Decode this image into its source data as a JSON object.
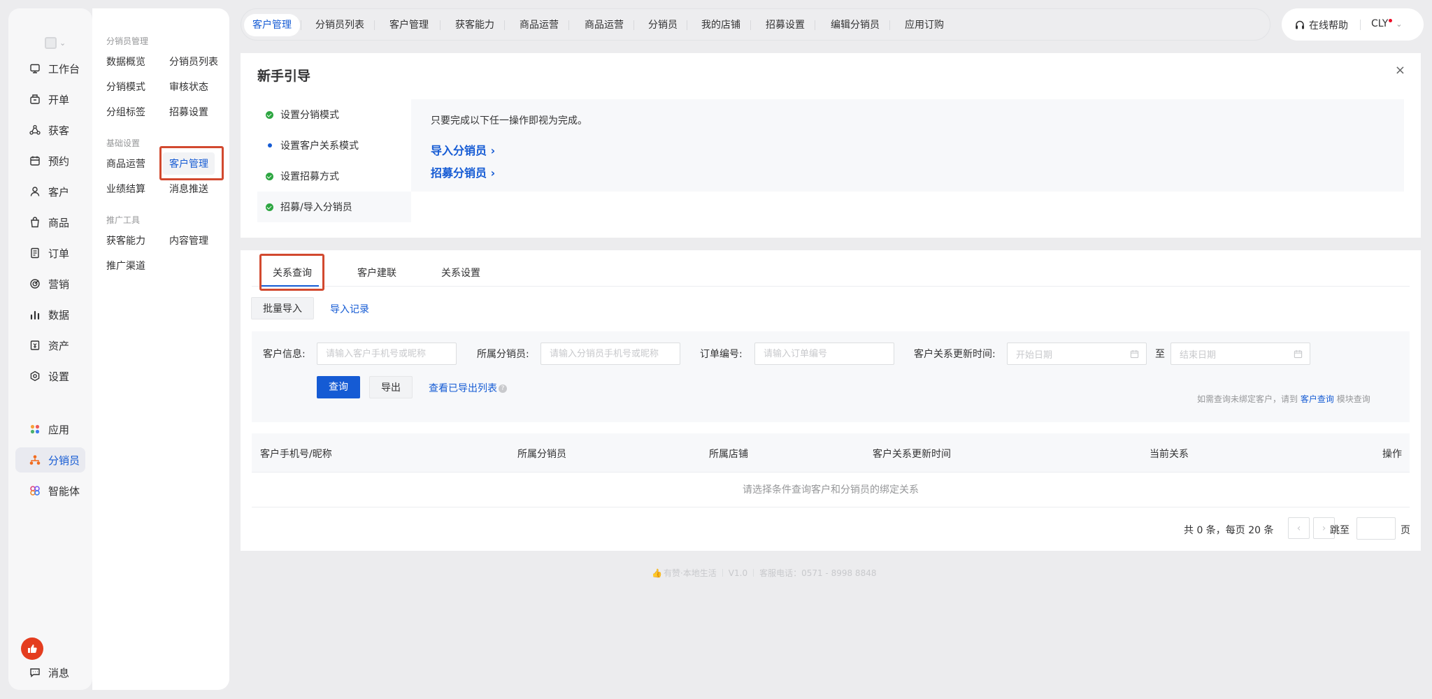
{
  "sidebar": {
    "items": [
      {
        "label": "工作台",
        "icon": "workbench-icon"
      },
      {
        "label": "开单",
        "icon": "cashier-icon"
      },
      {
        "label": "获客",
        "icon": "acquire-icon"
      },
      {
        "label": "预约",
        "icon": "calendar-icon"
      },
      {
        "label": "客户",
        "icon": "user-icon"
      },
      {
        "label": "商品",
        "icon": "bag-icon"
      },
      {
        "label": "订单",
        "icon": "order-icon"
      },
      {
        "label": "营销",
        "icon": "target-icon"
      },
      {
        "label": "数据",
        "icon": "chart-icon"
      },
      {
        "label": "资产",
        "icon": "asset-icon"
      },
      {
        "label": "设置",
        "icon": "gear-icon"
      },
      {
        "label": "应用",
        "icon": "apps-icon"
      },
      {
        "label": "分销员",
        "icon": "distributor-icon"
      },
      {
        "label": "智能体",
        "icon": "agent-icon"
      },
      {
        "label": "消息",
        "icon": "message-icon"
      }
    ]
  },
  "subnav": {
    "groups": [
      "分销员管理",
      "基础设置",
      "推广工具"
    ],
    "links": [
      "数据概览",
      "分销员列表",
      "分销模式",
      "审核状态",
      "分组标签",
      "招募设置",
      "商品运营",
      "客户管理",
      "业绩结算",
      "消息推送",
      "获客能力",
      "内容管理",
      "推广渠道"
    ]
  },
  "toptabs": [
    "客户管理",
    "分销员列表",
    "客户管理",
    "获客能力",
    "商品运营",
    "商品运营",
    "分销员",
    "我的店铺",
    "招募设置",
    "编辑分销员",
    "应用订购"
  ],
  "header": {
    "help": "在线帮助",
    "user": "CLY"
  },
  "guide": {
    "title": "新手引导",
    "close": "×",
    "steps": [
      "设置分销模式",
      "设置客户关系模式",
      "设置招募方式",
      "招募/导入分销员"
    ],
    "desc": "只要完成以下任一操作即视为完成。",
    "actions": [
      "导入分销员 ›",
      "招募分销员 ›"
    ]
  },
  "main": {
    "tabs": [
      "关系查询",
      "客户建联",
      "关系设置"
    ],
    "batch_import": "批量导入",
    "import_record": "导入记录",
    "filters": {
      "customer_label": "客户信息:",
      "customer_ph": "请输入客户手机号或昵称",
      "distributor_label": "所属分销员:",
      "distributor_ph": "请输入分销员手机号或昵称",
      "order_label": "订单编号:",
      "order_ph": "请输入订单编号",
      "time_label": "客户关系更新时间:",
      "start_date": "开始日期",
      "to": "至",
      "end_date": "结束日期"
    },
    "query": "查询",
    "export": "导出",
    "view_exported": "查看已导出列表",
    "hint_prefix": "如需查询未绑定客户，请到",
    "hint_link": "客户查询",
    "hint_suffix": "模块查询",
    "columns": [
      "客户手机号/昵称",
      "所属分销员",
      "所属店铺",
      "客户关系更新时间",
      "当前关系",
      "操作"
    ],
    "empty": "请选择条件查询客户和分销员的绑定关系",
    "pager_total": "共 0 条，每页 20 条",
    "jump_to": "跳至",
    "page_unit": "页"
  },
  "footer": {
    "brand": "有赞·本地生活",
    "version": "V1.0",
    "phone": "客服电话：0571 - 8998 8848"
  },
  "colors": {
    "accent": "#155bd4",
    "highlight": "#d2492f",
    "success": "#2da641"
  }
}
